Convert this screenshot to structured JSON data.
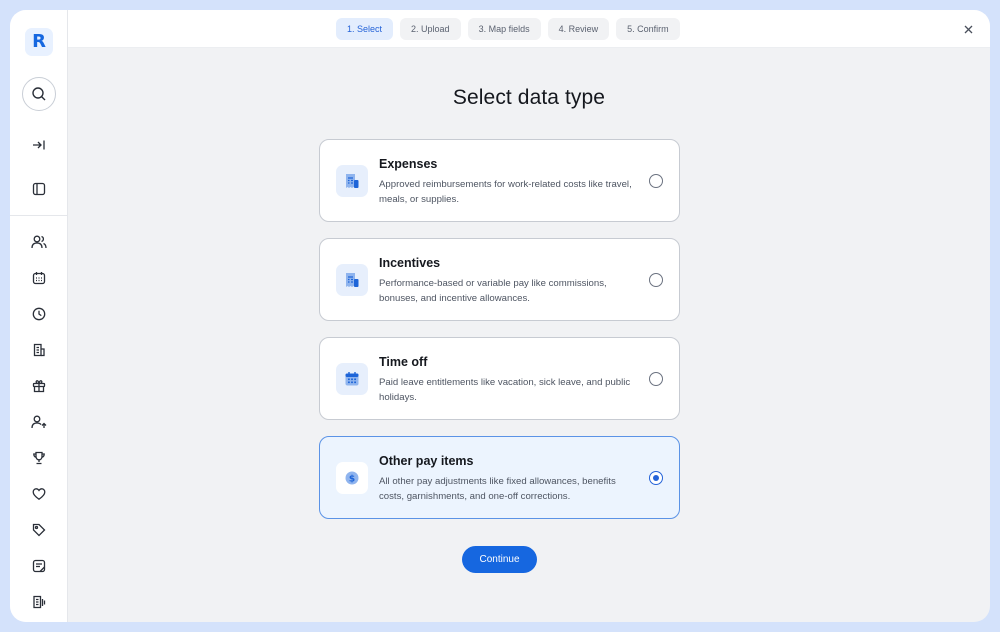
{
  "sidebar": {
    "logo_letter": "R",
    "icons": [
      "search-icon",
      "collapse-icon",
      "panel-icon",
      "people-icon",
      "calendar-icon",
      "clock-icon",
      "report-icon",
      "gift-icon",
      "user-growth-icon",
      "trophy-icon",
      "heart-icon",
      "tag-icon",
      "notes-icon",
      "documents-icon"
    ]
  },
  "stepper": {
    "steps": [
      "1.  Select",
      "2.  Upload",
      "3.  Map fields",
      "4.  Review",
      "5.  Confirm"
    ],
    "active_index": 0
  },
  "page": {
    "title": "Select data type"
  },
  "options": [
    {
      "title": "Expenses",
      "description": "Approved reimbursements for work-related costs like travel, meals, or supplies.",
      "icon": "receipt-icon",
      "selected": false
    },
    {
      "title": "Incentives",
      "description": "Performance-based or variable pay like commissions, bonuses, and incentive allowances.",
      "icon": "receipt-icon",
      "selected": false
    },
    {
      "title": "Time off",
      "description": "Paid leave entitlements like vacation, sick leave, and public holidays.",
      "icon": "calendar-icon",
      "selected": false
    },
    {
      "title": "Other pay items",
      "description": "All other pay adjustments like fixed allowances, benefits costs, garnishments, and one-off corrections.",
      "icon": "dollar-icon",
      "selected": true
    }
  ],
  "actions": {
    "continue_label": "Continue"
  },
  "colors": {
    "accent": "#1667e0",
    "selected_bg": "#ecf4fe",
    "page_bg": "#f1f2f4",
    "frame_bg": "#d4e2fb"
  }
}
